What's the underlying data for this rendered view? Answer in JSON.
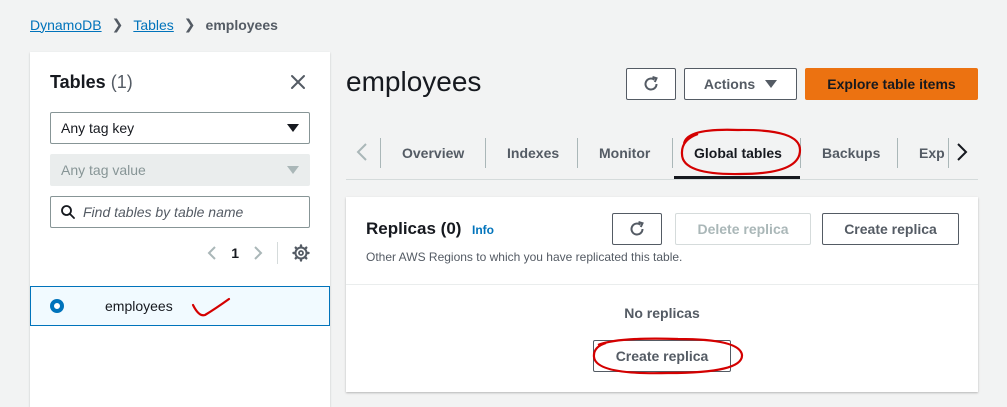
{
  "breadcrumb": {
    "root": "DynamoDB",
    "tables": "Tables",
    "current": "employees"
  },
  "left_panel": {
    "title": "Tables",
    "count": "(1)",
    "tag_key": "Any tag key",
    "tag_value": "Any tag value",
    "search_placeholder": "Find tables by table name",
    "page": "1",
    "items": [
      {
        "name": "employees",
        "selected": true
      }
    ]
  },
  "main": {
    "title": "employees",
    "actions_label": "Actions",
    "explore_label": "Explore table items",
    "tabs": [
      {
        "label": "Overview"
      },
      {
        "label": "Indexes"
      },
      {
        "label": "Monitor"
      },
      {
        "label": "Global tables",
        "active": true
      },
      {
        "label": "Backups"
      },
      {
        "label": "Exp"
      }
    ]
  },
  "replicas": {
    "title": "Replicas",
    "count": "(0)",
    "info": "Info",
    "description": "Other AWS Regions to which you have replicated this table.",
    "delete_label": "Delete replica",
    "create_label": "Create replica",
    "empty_title": "No replicas",
    "empty_create_label": "Create replica"
  },
  "colors": {
    "link": "#0073bb",
    "primary": "#ec7211",
    "annotation": "#d40000"
  },
  "icons": {
    "refresh": "refresh-icon",
    "close": "close-icon",
    "search": "search-icon",
    "settings": "gear-icon"
  }
}
